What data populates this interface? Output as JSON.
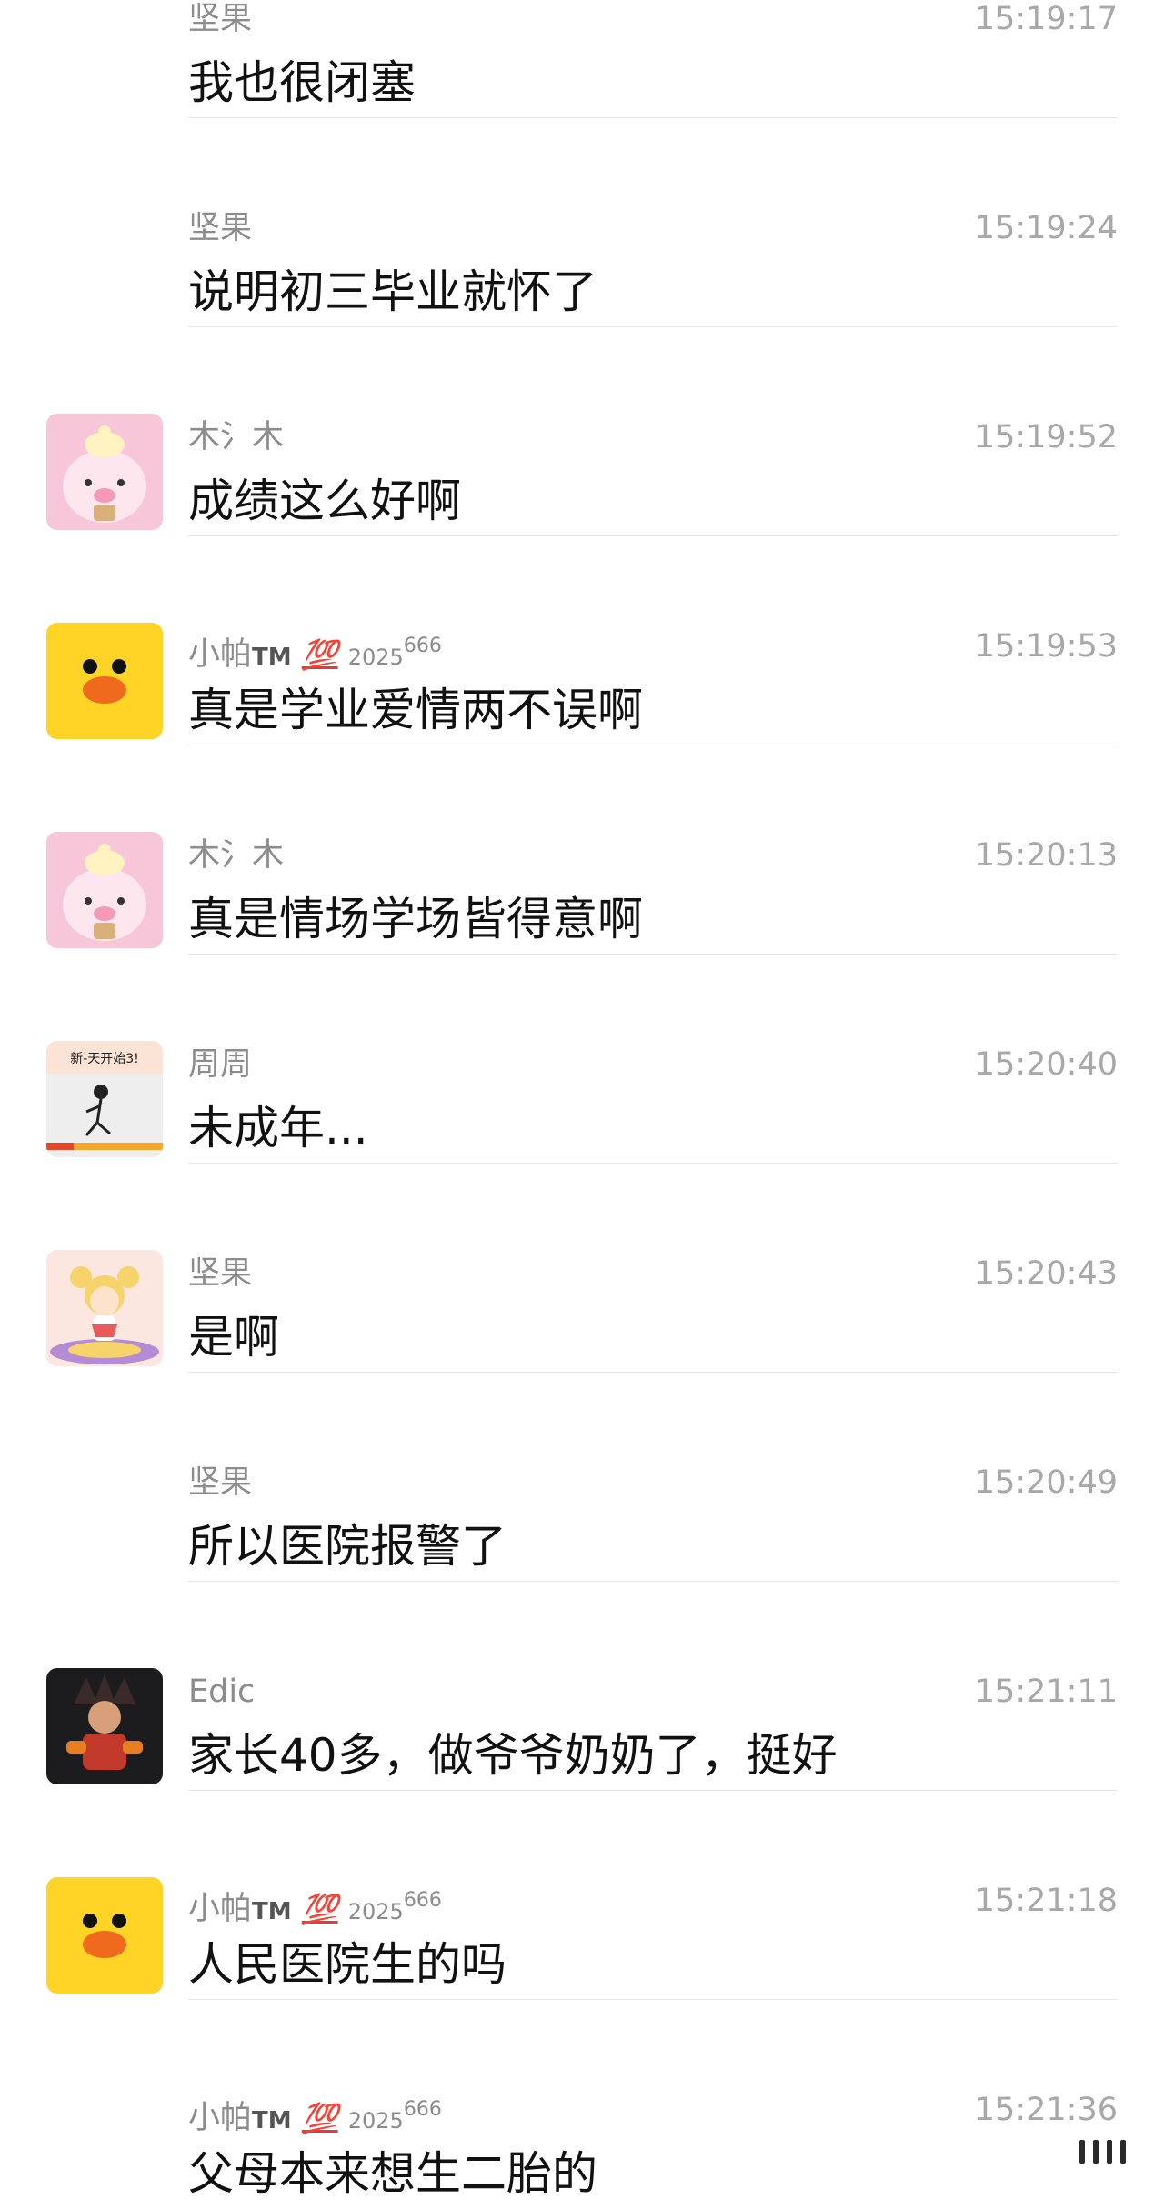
{
  "messages": [
    {
      "sender": "坚果",
      "time": "15:19:17",
      "text": "我也很闭塞",
      "avatar": "none"
    },
    {
      "sender": "坚果",
      "time": "15:19:24",
      "text": "说明初三毕业就怀了",
      "avatar": "none"
    },
    {
      "sender": "木氵木",
      "time": "15:19:52",
      "text": "成绩这么好啊",
      "avatar": "pig-avatar-icon"
    },
    {
      "sender": "小帕",
      "sender_tm": "TM",
      "sender_badge": "💯",
      "sender_year": "2025",
      "sender_sup": "666",
      "time": "15:19:53",
      "text": "真是学业爱情两不误啊",
      "avatar": "duck-avatar-icon"
    },
    {
      "sender": "木氵木",
      "time": "15:20:13",
      "text": "真是情场学场皆得意啊",
      "avatar": "pig-avatar-icon"
    },
    {
      "sender": "周周",
      "time": "15:20:40",
      "text": "未成年...",
      "avatar": "runner-avatar-icon",
      "avatar_caption": "新-天开始3!"
    },
    {
      "sender": "坚果",
      "time": "15:20:43",
      "text": "是啊",
      "avatar": "moon-girl-avatar-icon"
    },
    {
      "sender": "坚果",
      "time": "15:20:49",
      "text": "所以医院报警了",
      "avatar": "none"
    },
    {
      "sender": "Edic",
      "time": "15:21:11",
      "text": "家长40多，做爷爷奶奶了，挺好",
      "avatar": "fighter-avatar-icon"
    },
    {
      "sender": "小帕",
      "sender_tm": "TM",
      "sender_badge": "💯",
      "sender_year": "2025",
      "sender_sup": "666",
      "time": "15:21:18",
      "text": "人民医院生的吗",
      "avatar": "duck-avatar-icon"
    },
    {
      "sender": "小帕",
      "sender_tm": "TM",
      "sender_badge": "💯",
      "sender_year": "2025",
      "sender_sup": "666",
      "time": "15:21:36",
      "text": "父母本来想生二胎的",
      "avatar": "none"
    }
  ],
  "colors": {
    "name": "#8c8c8c",
    "time": "#a8a8a8",
    "text": "#111111",
    "divider": "#e7e7e7",
    "duck_bg": "#ffd426",
    "pig_bg": "#f7c6d9"
  }
}
